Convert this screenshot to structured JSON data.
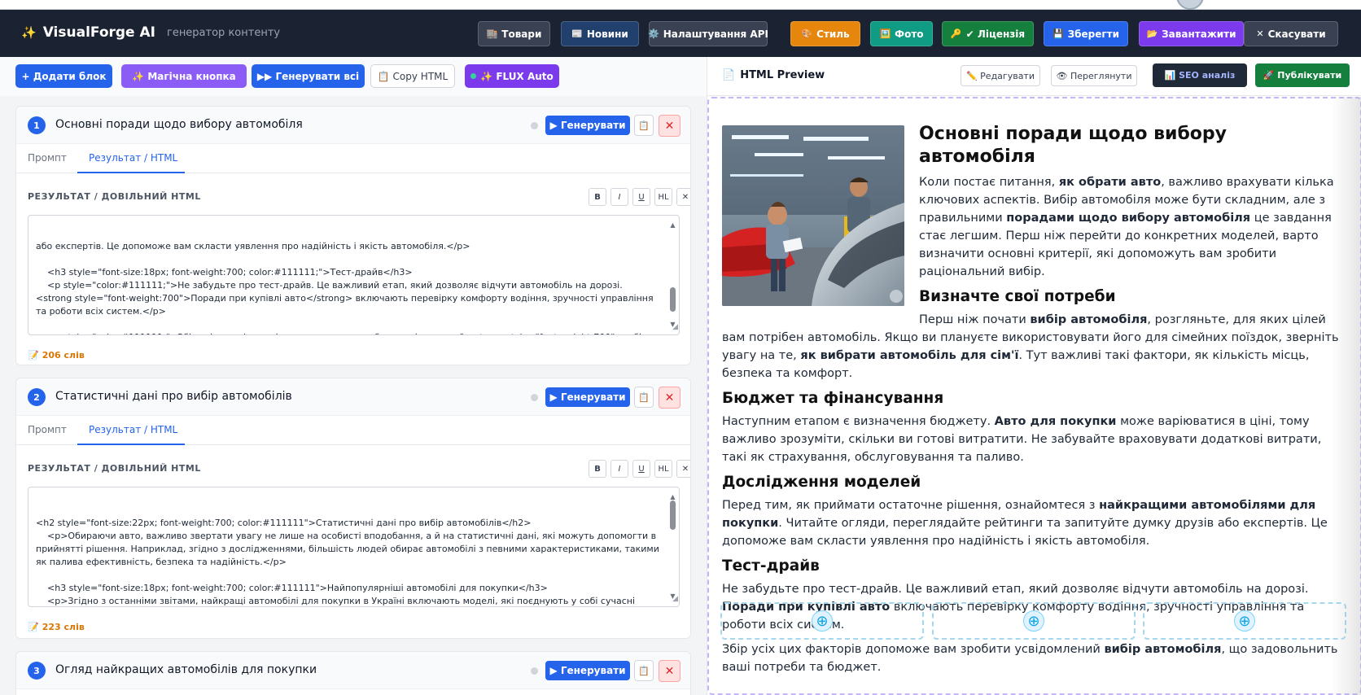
{
  "header": {
    "brand_icon": "✨",
    "title": "VisualForge AI",
    "subtitle": "генератор контенту",
    "buttons": [
      {
        "icon": "🏬",
        "label": "Товари",
        "color": "#3a4152"
      },
      {
        "icon": "📰",
        "label": "Новини",
        "color": "#22406e"
      },
      {
        "icon": "⚙️",
        "label": "Налаштування API",
        "color": "#3a4152"
      },
      {
        "icon": "🎨",
        "label": "Стиль",
        "color": "#e6860d"
      },
      {
        "icon": "🖼️",
        "label": "Фото",
        "color": "#0f9b84"
      },
      {
        "icon": "🔑",
        "label": "✔ Ліцензія",
        "color": "#15803d"
      },
      {
        "icon": "💾",
        "label": "Зберегти",
        "color": "#2563eb"
      },
      {
        "icon": "📂",
        "label": "Завантажити",
        "color": "#7c3aed"
      },
      {
        "icon": "✕",
        "label": "Скасувати",
        "color": "#3a4152"
      }
    ]
  },
  "toolbar": {
    "add_block": "+ Додати блок",
    "magic": "✨ Магічна кнопка",
    "generate_all": "▶▶ Генерувати всі",
    "copy_html": "📋 Copy HTML",
    "flux": "✨ FLUX Auto"
  },
  "cards": [
    {
      "number": "1",
      "title": "Основні поради щодо вибору автомобіля",
      "generate": "▶ Генерувати",
      "tabs": [
        "Промпт",
        "Результат / HTML"
      ],
      "result_label": "РЕЗУЛЬТАТ / ДОВІЛЬНИЙ HTML",
      "format_buttons": [
        "B",
        "I",
        "U",
        "HL",
        "✕"
      ],
      "code": "або експертів. Це допоможе вам скласти уявлення про надійність і якість автомобіля.</p>\n\n    <h3 style=\"font-size:18px; font-weight:700; color:#111111;\">Тест-драйв</h3>\n    <p style=\"color:#111111;\">Не забудьте про тест-драйв. Це важливий етап, який дозволяє відчути автомобіль на дорозі. <strong style=\"font-weight:700\">Поради при купівлі авто</strong> включають перевірку комфорту водіння, зручності управління та роботи всіх систем.</p>\n\n    <p style=\"color:#111111;\">Збір усіх цих факторів допоможе вам зробити усвідомлений <strong style=\"font-weight:700\">вибір автомобіля</strong>, що задовольнить ваші потреби та бюджет.</p>",
      "scroll_pos": 0.62,
      "words": "206 слів"
    },
    {
      "number": "2",
      "title": "Статистичні дані про вибір автомобілів",
      "generate": "▶ Генерувати",
      "tabs": [
        "Промпт",
        "Результат / HTML"
      ],
      "result_label": "РЕЗУЛЬТАТ / ДОВІЛЬНИЙ HTML",
      "format_buttons": [
        "B",
        "I",
        "U",
        "HL",
        "✕"
      ],
      "code": "<h2 style=\"font-size:22px; font-weight:700; color:#111111\">Статистичні дані про вибір автомобілів</h2>\n    <p>Обираючи авто, важливо звертати увагу не лише на особисті вподобання, а й на статистичні дані, які можуть допомогти в прийнятті рішення. Наприклад, згідно з дослідженнями, більшість людей обирає автомобілі з певними характеристиками, такими як палива ефективність, безпека та надійність.</p>\n\n    <h3 style=\"font-size:18px; font-weight:700; color:#111111\">Найпопулярніші автомобілі для покупки</h3>\n    <p>Згідно з останніми звітами, найкращі автомобілі для покупки в Україні включають моделі, які поєднують у собі сучасні технології, комфорт та доступність. Серед лідерів продажів часто опиняються марки, що пропонують якісні SUV та компактні седани. Також важливо враховувати, що зростає попит на електромобілі, що свідчить про зміну споживчих вподобань.</p>",
      "scroll_pos": 0.0,
      "words": "223 слів"
    },
    {
      "number": "3",
      "title": "Огляд найкращих автомобілів для покупки",
      "generate": "▶ Генерувати"
    }
  ],
  "preview": {
    "title": "HTML Preview",
    "edit": "✏️ Редагувати",
    "view": "👁 Переглянути",
    "seo": "📊 SEO аналіз",
    "publish": "🚀 Публікувати",
    "h2": "Основні поради щодо вибору автомобіля",
    "p1_a": "Коли постає питання, ",
    "p1_b": "як обрати авто",
    "p1_c": ", важливо врахувати кілька ключових аспектів. Вибір автомобіля може бути складним, але з правильними ",
    "p1_d": "порадами щодо вибору автомобіля",
    "p1_e": " це завдання стає легшим. Перш ніж перейти до конкретних моделей, варто визначити основні критерії, які допоможуть вам зробити раціональний вибір.",
    "h3_1": "Визначте свої потреби",
    "p2_a": "Перш ніж почати ",
    "p2_b": "вибір автомобіля",
    "p2_c": ", розгляньте, для яких цілей вам потрібен автомобіль. Якщо ви плануєте використовувати його для сімейних поїздок, зверніть увагу на те, ",
    "p2_d": "як вибрати автомобіль для сім'ї",
    "p2_e": ". Тут важливі такі фактори, як кількість місць, безпека та комфорт.",
    "h3_2": "Бюджет та фінансування",
    "p3_a": "Наступним етапом є визначення бюджету. ",
    "p3_b": "Авто для покупки",
    "p3_c": " може варіюватися в ціні, тому важливо зрозуміти, скільки ви готові витратити. Не забувайте враховувати додаткові витрати, такі як страхування, обслуговування та паливо.",
    "h3_3": "Дослідження моделей",
    "p4_a": "Перед тим, як приймати остаточне рішення, ознайомтеся з ",
    "p4_b": "найкращими автомобілями для покупки",
    "p4_c": ". Читайте огляди, переглядайте рейтинги та запитуйте думку друзів або експертів. Це допоможе вам скласти уявлення про надійність і якість автомобіля.",
    "h3_4": "Тест-драйв",
    "p5_a": "Не забудьте про тест-драйв. Це важливий етап, який дозволяє відчути автомобіль на дорозі. ",
    "p5_b": "Поради при купівлі авто",
    "p5_c": " включають перевірку комфорту водіння, зручності управління та роботи всіх систем.",
    "p6_a": "Збір усіх цих факторів допоможе вам зробити усвідомлений ",
    "p6_b": "вибір автомобіля",
    "p6_c": ", що задовольнить ваші потреби та бюджет.",
    "slot_icon": "⊕"
  }
}
